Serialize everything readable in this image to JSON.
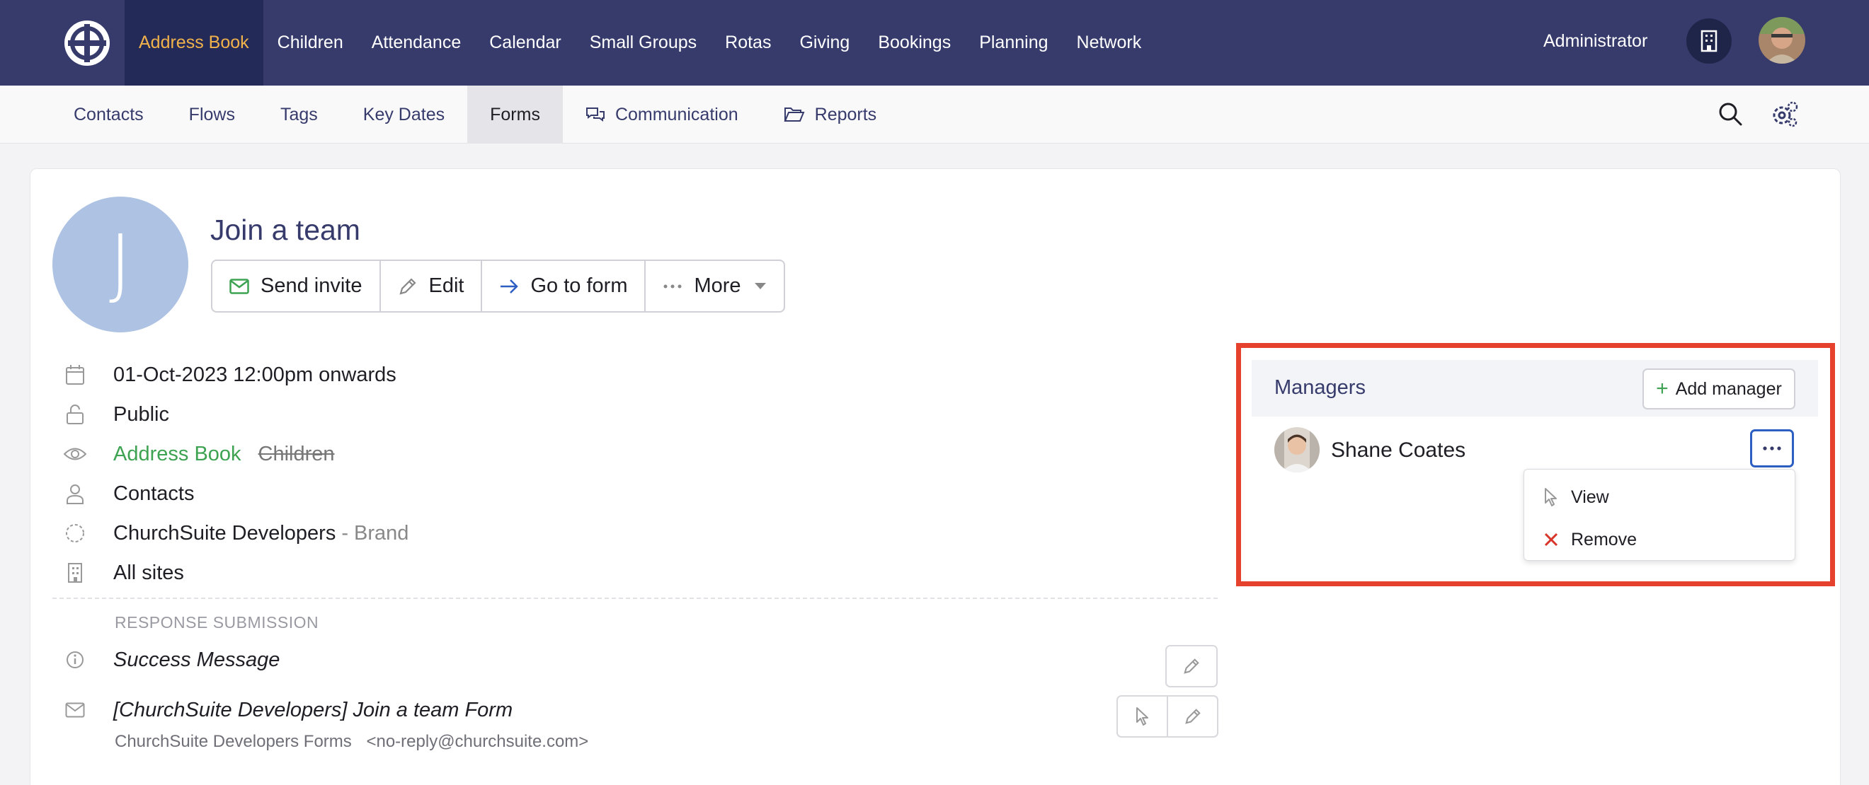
{
  "topnav": {
    "items": [
      "Address Book",
      "Children",
      "Attendance",
      "Calendar",
      "Small Groups",
      "Rotas",
      "Giving",
      "Bookings",
      "Planning",
      "Network"
    ],
    "active_index": 0,
    "user_label": "Administrator"
  },
  "subnav": {
    "items": [
      {
        "label": "Contacts",
        "icon": ""
      },
      {
        "label": "Flows",
        "icon": ""
      },
      {
        "label": "Tags",
        "icon": ""
      },
      {
        "label": "Key Dates",
        "icon": ""
      },
      {
        "label": "Forms",
        "icon": ""
      },
      {
        "label": "Communication",
        "icon": "chat-bubbles-icon"
      },
      {
        "label": "Reports",
        "icon": "folder-open-icon"
      }
    ],
    "active_index": 4
  },
  "form": {
    "avatar_initial": "J",
    "title": "Join a team",
    "buttons": {
      "send_invite": "Send invite",
      "edit": "Edit",
      "go_to_form": "Go to form",
      "more": "More"
    }
  },
  "details": {
    "date": "01-Oct-2023 12:00pm onwards",
    "visibility": "Public",
    "modules": {
      "active": "Address Book",
      "inactive": "Children"
    },
    "audience": "Contacts",
    "brand_name": "ChurchSuite Developers",
    "brand_suffix": "- Brand",
    "sites": "All sites"
  },
  "response": {
    "section_label": "RESPONSE SUBMISSION",
    "success_message": "Success Message",
    "email_subject": "[ChurchSuite Developers] Join a team Form",
    "sender_name": "ChurchSuite Developers Forms",
    "sender_email": "<no-reply@churchsuite.com>"
  },
  "managers": {
    "title": "Managers",
    "add_label": "Add manager",
    "list": [
      {
        "name": "Shane Coates"
      }
    ],
    "menu": {
      "view": "View",
      "remove": "Remove"
    }
  },
  "colors": {
    "topbar": "#363b6c",
    "active_nav_text": "#f0b24a",
    "accent_green": "#3da352",
    "highlight_red": "#e5412c",
    "focus_blue": "#2d5fc2"
  }
}
